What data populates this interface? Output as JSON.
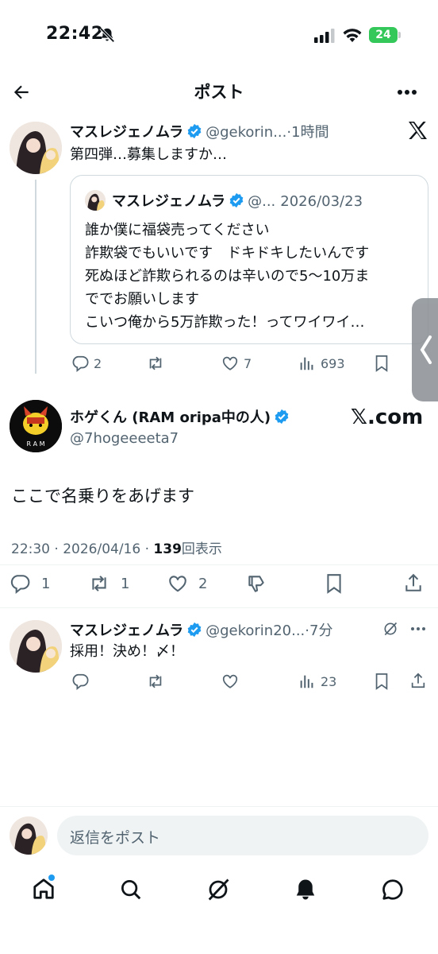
{
  "status_bar": {
    "time": "22:42",
    "battery": "24"
  },
  "header": {
    "title": "ポスト"
  },
  "parent_post": {
    "name": "マスレジェノムラ",
    "handle": "@gekorin...",
    "dot": "·",
    "time": "1時間",
    "text": "第四弾…募集しますか…",
    "quote": {
      "name": "マスレジェノムラ",
      "handle": "@...",
      "date": "2026/03/23",
      "lines": [
        "誰か僕に福袋売ってください",
        "詐欺袋でもいいです　ドキドキしたいんです",
        "死ぬほど詐欺られるのは辛いので5〜10万ま",
        "ででお願いします",
        "こいつ俺から5万詐欺った！ってワイワイ…"
      ]
    },
    "actions": {
      "replies": "2",
      "likes": "7",
      "views": "693"
    }
  },
  "main_post": {
    "name": "ホゲくん (RAM oripa中の人)",
    "handle": "@7hogeeeeta7",
    "source": "𝕏.com",
    "text": "ここで名乗りをあげます",
    "time": "22:30 · 2026/04/16 · ",
    "view_count": "139",
    "view_label": "回表示",
    "actions": {
      "replies": "1",
      "reposts": "1",
      "likes": "2"
    }
  },
  "reply_post": {
    "name": "マスレジェノムラ",
    "handle": "@gekorin20...",
    "dot": "·",
    "time": "7分",
    "text": "採用！決め！〆！",
    "actions": {
      "views": "23"
    }
  },
  "reply_box": {
    "placeholder": "返信をポスト"
  },
  "colors": {
    "verified": "#1d9bf0",
    "text": "#0f1419",
    "muted": "#536471",
    "border": "#cfd9de"
  }
}
